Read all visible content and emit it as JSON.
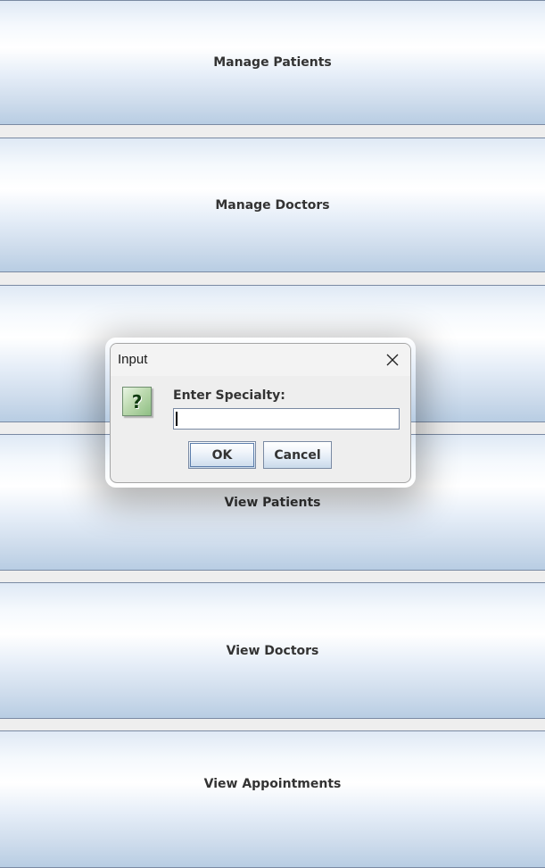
{
  "menu": {
    "buttons": [
      {
        "label": "Manage Patients"
      },
      {
        "label": "Manage Doctors"
      },
      {
        "label": ""
      },
      {
        "label": "View Patients"
      },
      {
        "label": "View Doctors"
      },
      {
        "label": "View Appointments"
      }
    ]
  },
  "dialog": {
    "title": "Input",
    "prompt": "Enter Specialty:",
    "input_value": "",
    "ok_label": "OK",
    "cancel_label": "Cancel",
    "icon": "question-icon",
    "question_glyph": "?"
  },
  "colors": {
    "button_border": "#7a8aa3",
    "button_highlight": "#ffffff",
    "button_shade": "#b8cde3",
    "question_icon_green": "#8fbf84"
  }
}
